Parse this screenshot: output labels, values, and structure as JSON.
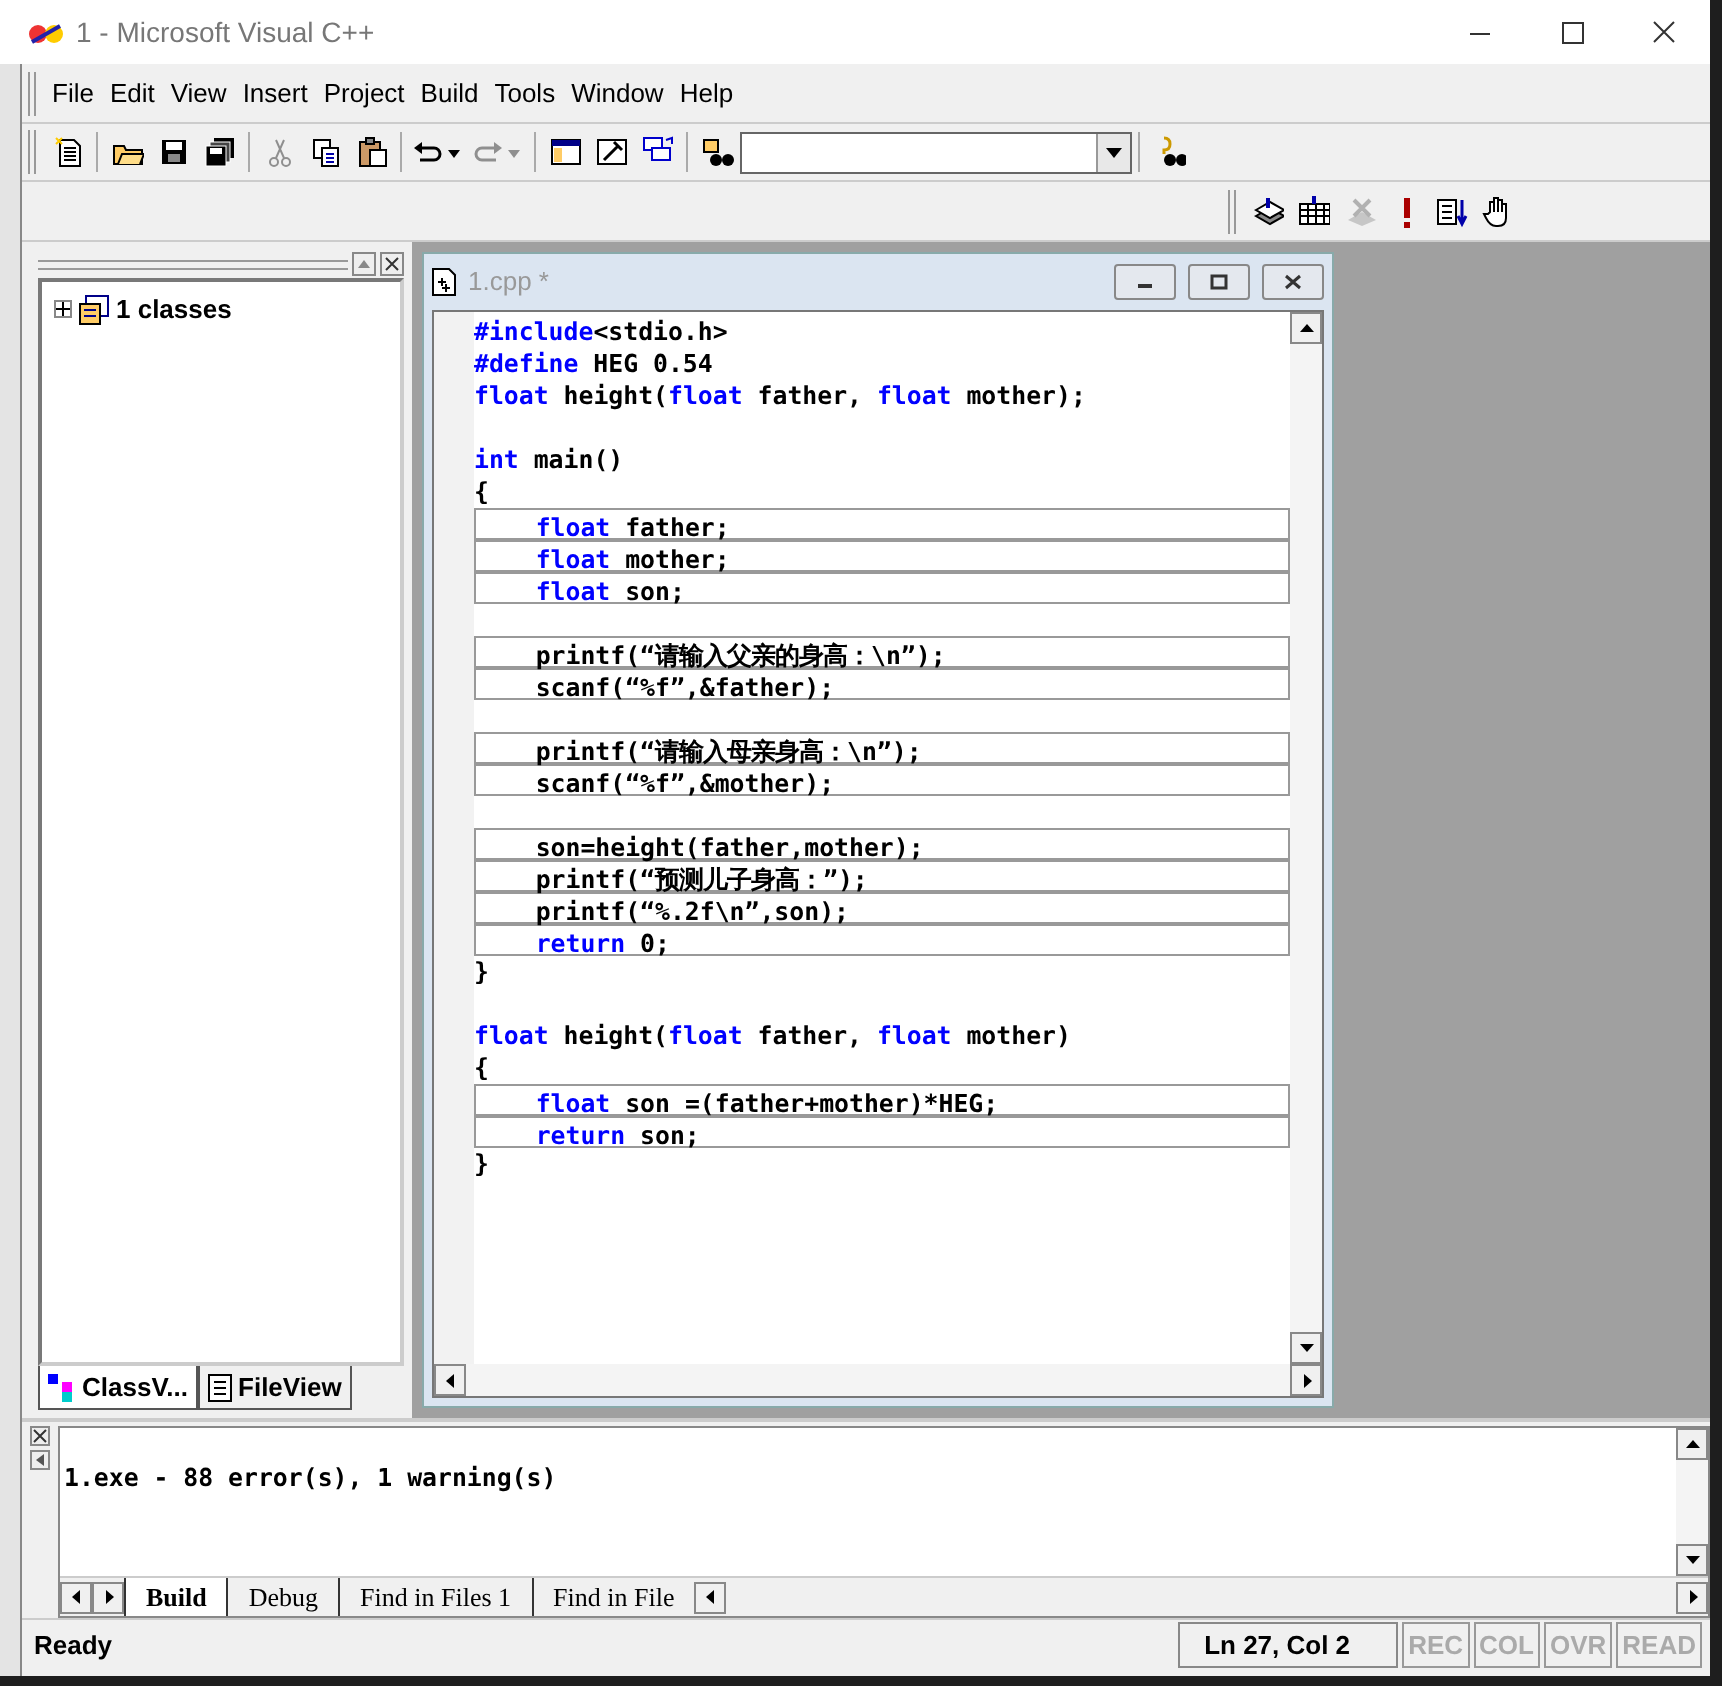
{
  "window": {
    "title": "1 - Microsoft Visual C++"
  },
  "menu": [
    "File",
    "Edit",
    "View",
    "Insert",
    "Project",
    "Build",
    "Tools",
    "Window",
    "Help"
  ],
  "toolbar": [
    {
      "kind": "new",
      "disabled": false
    },
    {
      "kind": "sep"
    },
    {
      "kind": "open",
      "disabled": false
    },
    {
      "kind": "save",
      "disabled": false
    },
    {
      "kind": "saveall",
      "disabled": false
    },
    {
      "kind": "sep"
    },
    {
      "kind": "cut",
      "disabled": true
    },
    {
      "kind": "copy",
      "disabled": false
    },
    {
      "kind": "paste",
      "disabled": false
    },
    {
      "kind": "sep"
    },
    {
      "kind": "undo",
      "disabled": false
    },
    {
      "kind": "redo",
      "disabled": true
    },
    {
      "kind": "sep"
    },
    {
      "kind": "workspace",
      "disabled": false
    },
    {
      "kind": "output",
      "disabled": false
    },
    {
      "kind": "windows",
      "disabled": false
    },
    {
      "kind": "sep"
    },
    {
      "kind": "find",
      "disabled": false
    },
    {
      "kind": "combo"
    },
    {
      "kind": "sep"
    },
    {
      "kind": "help",
      "disabled": false
    }
  ],
  "build_toolbar": [
    {
      "kind": "compile",
      "disabled": false
    },
    {
      "kind": "build",
      "disabled": false
    },
    {
      "kind": "stop",
      "disabled": true
    },
    {
      "kind": "execute",
      "disabled": false
    },
    {
      "kind": "go",
      "disabled": false
    },
    {
      "kind": "breakpoint",
      "disabled": false
    }
  ],
  "workspace": {
    "tree": [
      {
        "label": "1 classes",
        "expanded": false
      }
    ],
    "tabs": [
      {
        "label": "ClassV...",
        "selected": true
      },
      {
        "label": "FileView",
        "selected": false
      }
    ]
  },
  "editor": {
    "title": "1.cpp *",
    "lines": [
      {
        "tokens": [
          {
            "text": "#include",
            "kind": "keyword"
          },
          {
            "text": "<stdio.h>",
            "kind": "plain"
          }
        ]
      },
      {
        "tokens": [
          {
            "text": "#define",
            "kind": "keyword"
          },
          {
            "text": " HEG 0.54",
            "kind": "plain"
          }
        ]
      },
      {
        "tokens": [
          {
            "text": "float",
            "kind": "keyword"
          },
          {
            "text": " height(",
            "kind": "plain"
          },
          {
            "text": "float",
            "kind": "keyword"
          },
          {
            "text": " father, ",
            "kind": "plain"
          },
          {
            "text": "float",
            "kind": "keyword"
          },
          {
            "text": " mother);",
            "kind": "plain"
          }
        ]
      },
      {
        "kind": "blank"
      },
      {
        "tokens": [
          {
            "text": "int",
            "kind": "keyword"
          },
          {
            "text": " main()",
            "kind": "plain"
          }
        ]
      },
      {
        "tokens": [
          {
            "text": "{",
            "kind": "plain"
          }
        ]
      },
      {
        "indent": true,
        "tokens": [
          {
            "text": "float",
            "kind": "keyword"
          },
          {
            "text": " father;",
            "kind": "plain"
          }
        ]
      },
      {
        "indent": true,
        "tokens": [
          {
            "text": "float",
            "kind": "keyword"
          },
          {
            "text": " mother;",
            "kind": "plain"
          }
        ]
      },
      {
        "indent": true,
        "tokens": [
          {
            "text": "float",
            "kind": "keyword"
          },
          {
            "text": " son;",
            "kind": "plain"
          }
        ]
      },
      {
        "kind": "blank"
      },
      {
        "indent": true,
        "tokens": [
          {
            "text": "printf(“请输入父亲的身高：\\n”);",
            "kind": "plain"
          }
        ]
      },
      {
        "indent": true,
        "tokens": [
          {
            "text": "scanf(“%f”,&father);",
            "kind": "plain"
          }
        ]
      },
      {
        "kind": "blank"
      },
      {
        "indent": true,
        "tokens": [
          {
            "text": "printf(“请输入母亲身高：\\n”);",
            "kind": "plain"
          }
        ]
      },
      {
        "indent": true,
        "tokens": [
          {
            "text": "scanf(“%f”,&mother);",
            "kind": "plain"
          }
        ]
      },
      {
        "kind": "blank"
      },
      {
        "indent": true,
        "tokens": [
          {
            "text": "son=height(father,mother);",
            "kind": "plain"
          }
        ]
      },
      {
        "indent": true,
        "tokens": [
          {
            "text": "printf(“预测儿子身高：”);",
            "kind": "plain"
          }
        ]
      },
      {
        "indent": true,
        "tokens": [
          {
            "text": "printf(“%.2f\\n”,son);",
            "kind": "plain"
          }
        ]
      },
      {
        "indent": true,
        "tokens": [
          {
            "text": "return",
            "kind": "keyword"
          },
          {
            "text": " 0;",
            "kind": "plain"
          }
        ]
      },
      {
        "tokens": [
          {
            "text": "}",
            "kind": "plain"
          }
        ]
      },
      {
        "kind": "blank"
      },
      {
        "tokens": [
          {
            "text": "float",
            "kind": "keyword"
          },
          {
            "text": " height(",
            "kind": "plain"
          },
          {
            "text": "float",
            "kind": "keyword"
          },
          {
            "text": " father, ",
            "kind": "plain"
          },
          {
            "text": "float",
            "kind": "keyword"
          },
          {
            "text": " mother)",
            "kind": "plain"
          }
        ]
      },
      {
        "tokens": [
          {
            "text": "{",
            "kind": "plain"
          }
        ]
      },
      {
        "indent": true,
        "tokens": [
          {
            "text": "float",
            "kind": "keyword"
          },
          {
            "text": " son =(father+mother)*HEG;",
            "kind": "plain"
          }
        ]
      },
      {
        "indent": true,
        "tokens": [
          {
            "text": "return",
            "kind": "keyword"
          },
          {
            "text": " son;",
            "kind": "plain"
          }
        ]
      },
      {
        "tokens": [
          {
            "text": "}",
            "kind": "plain"
          }
        ]
      }
    ]
  },
  "output": {
    "lines": [
      "1.exe - 88 error(s), 1 warning(s)"
    ],
    "tabs": [
      {
        "label": "Build",
        "selected": true
      },
      {
        "label": "Debug",
        "selected": false
      },
      {
        "label": "Find in Files 1",
        "selected": false
      },
      {
        "label": "Find in File",
        "selected": false
      }
    ]
  },
  "status_bar": {
    "message": "Ready",
    "position": "Ln 27, Col 2",
    "indicators": [
      {
        "label": "REC",
        "disabled": true
      },
      {
        "label": "COL",
        "disabled": true
      },
      {
        "label": "OVR",
        "disabled": true
      },
      {
        "label": "READ",
        "disabled": true
      }
    ]
  }
}
